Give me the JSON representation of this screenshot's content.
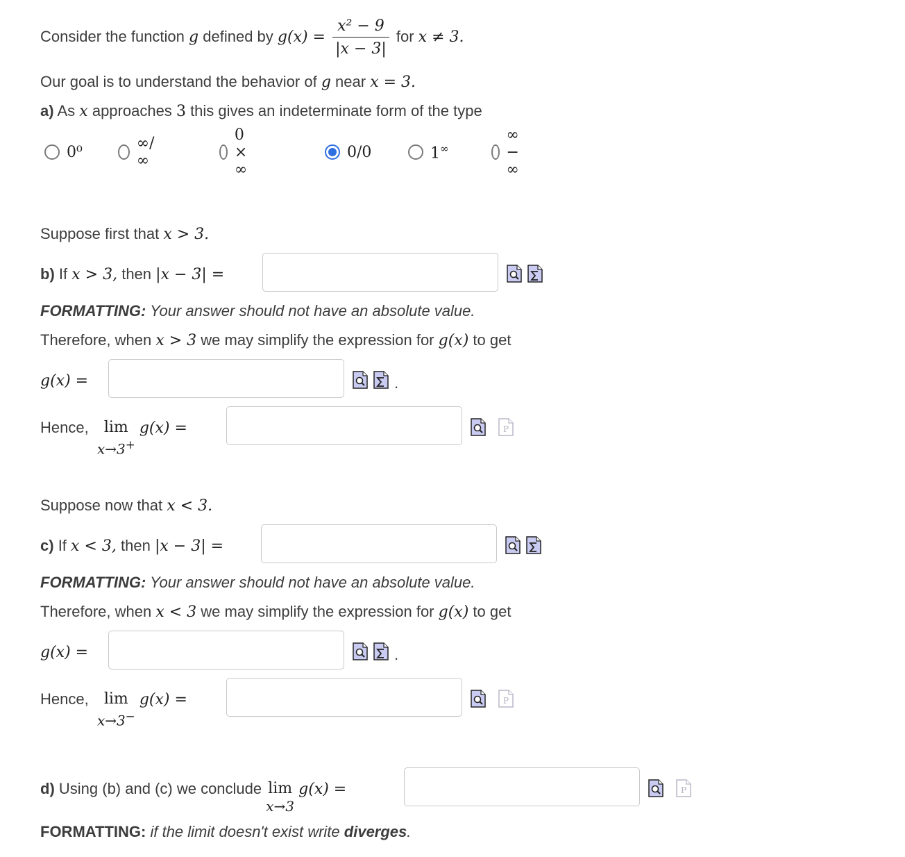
{
  "intro": {
    "prefix": "Consider the function",
    "g": "g",
    "defined_by": "defined by",
    "gx": "g(x) =",
    "numerator": "x² − 9",
    "denominator": "|x − 3|",
    "for_text": "for",
    "condition": "x ≠ 3."
  },
  "goal": {
    "text": "Our goal is to understand the behavior of",
    "g": "g",
    "near": "near",
    "point": "x = 3."
  },
  "part_a": {
    "label": "a)",
    "text1": "As",
    "x": "x",
    "text2": "approaches",
    "three": "3",
    "text3": "this gives an indeterminate form of the type",
    "options": [
      "0⁰",
      "∞/∞",
      "0 × ∞",
      "0/0",
      "1^∞",
      "∞ − ∞"
    ],
    "selected": "0/0"
  },
  "section_b_intro": {
    "text": "Suppose first that",
    "cond": "x > 3."
  },
  "part_b": {
    "label": "b)",
    "if": "If",
    "cond": "x > 3,",
    "then": "then",
    "expr": "|x − 3| =",
    "formatting_label": "FORMATTING:",
    "formatting_text": "Your answer should not have an absolute value.",
    "therefore": "Therefore, when",
    "cond2": "x > 3",
    "simplify": "we may simplify the expression for",
    "gx": "g(x)",
    "to_get": "to get",
    "gx_eq": "g(x) =",
    "period": ".",
    "hence": "Hence,",
    "lim": "lim",
    "lim_sub": "x→3",
    "lim_sup": "+",
    "lim_expr": "g(x) ="
  },
  "section_c_intro": {
    "text": "Suppose now that",
    "cond": "x < 3."
  },
  "part_c": {
    "label": "c)",
    "if": "If",
    "cond": "x < 3,",
    "then": "then",
    "expr": "|x − 3| =",
    "formatting_label": "FORMATTING:",
    "formatting_text": "Your answer should not have an absolute value.",
    "therefore": "Therefore, when",
    "cond2": "x < 3",
    "simplify": "we may simplify the expression for",
    "gx": "g(x)",
    "to_get": "to get",
    "gx_eq": "g(x) =",
    "period": ".",
    "hence": "Hence,",
    "lim": "lim",
    "lim_sub": "x→3",
    "lim_sup": "−",
    "lim_expr": "g(x) ="
  },
  "part_d": {
    "label": "d)",
    "text": "Using (b) and (c) we conclude",
    "lim": "lim",
    "lim_sub": "x→3",
    "lim_expr": "g(x) =",
    "formatting_label": "FORMATTING:",
    "formatting_text": "if the limit doesn't exist write",
    "formatting_word": "diverges",
    "formatting_end": "."
  },
  "colors": {
    "radio_selected": "#2f6fe0",
    "icon_fill": "#c9cbf2",
    "icon_border": "#222222"
  },
  "icons": {
    "preview": "preview-icon",
    "equation_editor": "equation-editor-icon",
    "text_mode": "text-mode-icon"
  }
}
